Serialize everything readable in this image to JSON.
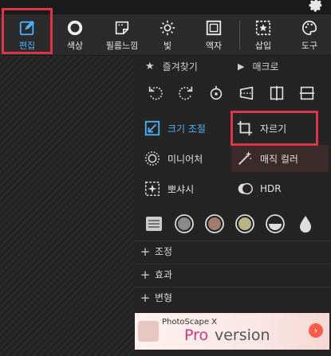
{
  "toolbar": {
    "tools": [
      {
        "id": "edit",
        "label": "편집",
        "icon": "edit-icon",
        "active": true
      },
      {
        "id": "color",
        "label": "색상",
        "icon": "color-circle-icon"
      },
      {
        "id": "film",
        "label": "필름느낌",
        "icon": "film-icon"
      },
      {
        "id": "light",
        "label": "빛",
        "icon": "sun-icon"
      },
      {
        "id": "frame",
        "label": "액자",
        "icon": "frame-icon"
      },
      {
        "id": "insert",
        "label": "삽입",
        "icon": "insert-star-icon"
      },
      {
        "id": "tools",
        "label": "도구",
        "icon": "palette-icon"
      }
    ]
  },
  "panel": {
    "favorites_label": "즐겨찾기",
    "macro_label": "매크로",
    "actions": {
      "resize": "크기 조절",
      "crop": "자르기",
      "miniature": "미니어처",
      "magic_color": "매직 컬러",
      "bokeh": "뽀샤시",
      "hdr": "HDR"
    },
    "sections": [
      {
        "label": "조정"
      },
      {
        "label": "효과"
      },
      {
        "label": "변형"
      }
    ]
  },
  "ad": {
    "brand": "PhotoScape X",
    "pro": "Pro",
    "version": "version"
  },
  "colors": {
    "accent": "#4ab3ff",
    "highlight": "#e0344a",
    "background": "#242424"
  }
}
